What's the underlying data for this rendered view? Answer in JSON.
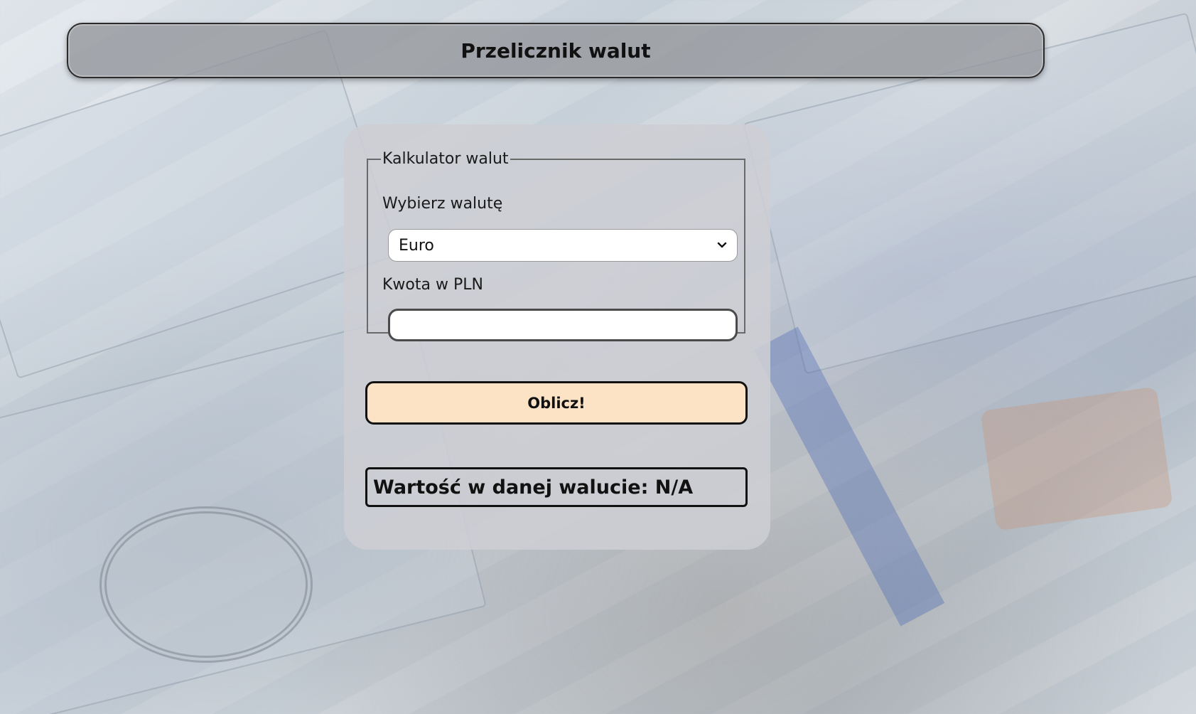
{
  "header": {
    "title": "Przelicznik walut"
  },
  "calculator": {
    "legend": "Kalkulator walut",
    "currency_label": "Wybierz walutę",
    "currency_selected": "Euro",
    "amount_label": "Kwota w PLN",
    "amount_value": "",
    "submit_label": "Oblicz!",
    "result_text": "Wartość w danej walucie: N/A"
  },
  "icons": {
    "dropdown": "chevron-down-icon"
  },
  "colors": {
    "button_bg": "#fde3c6",
    "border": "#111111"
  }
}
